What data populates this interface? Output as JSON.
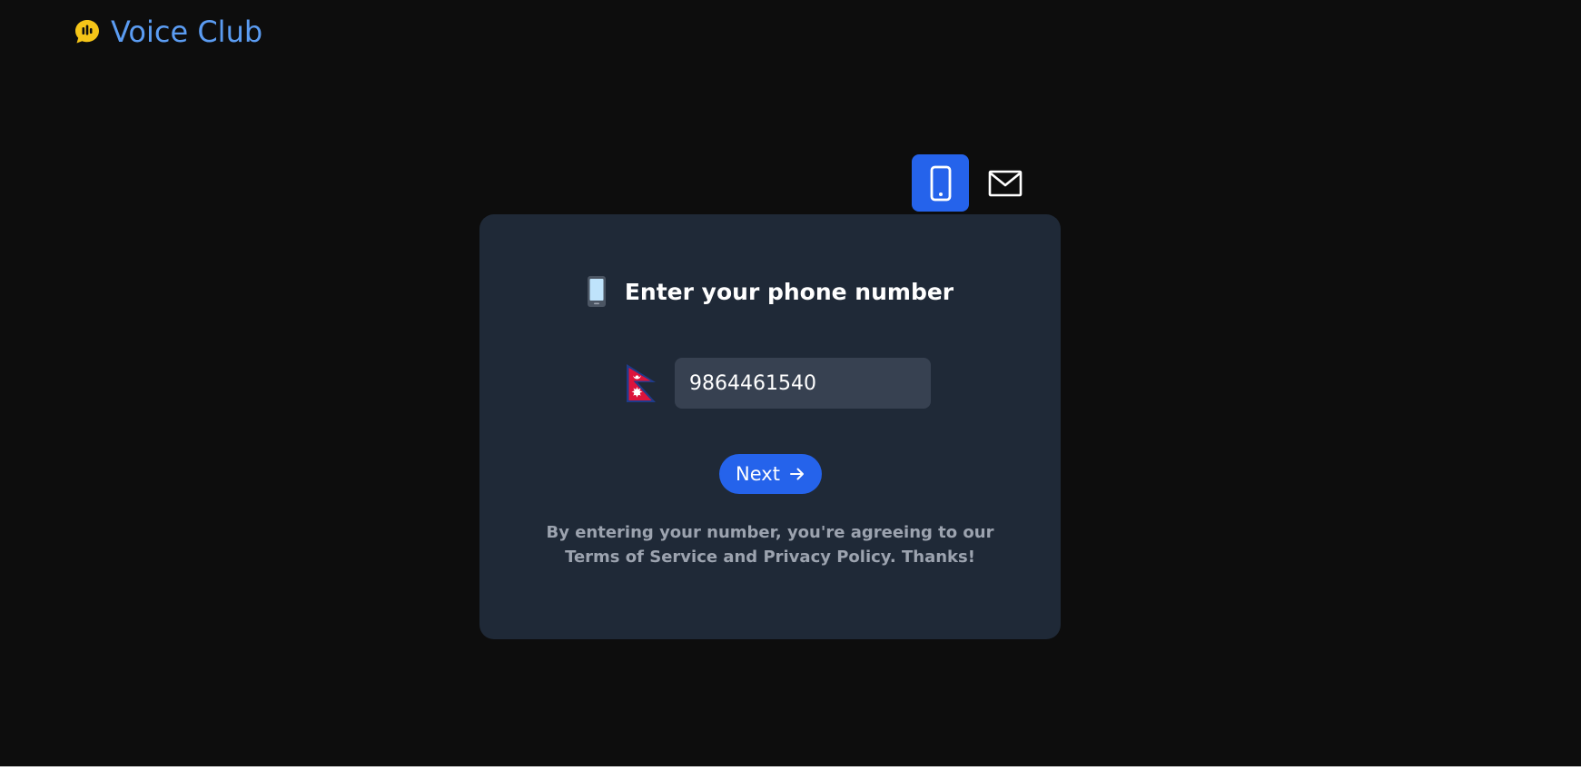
{
  "brand": {
    "name": "Voice Club",
    "logo_icon": "speech-bubble-audio-icon",
    "logo_color": "#f5c518",
    "text_color": "#5b9cf2"
  },
  "tabs": [
    {
      "icon": "phone-icon",
      "active": true
    },
    {
      "icon": "mail-icon",
      "active": false
    }
  ],
  "card": {
    "icon": "mobile-phone-icon",
    "heading": "Enter your phone number",
    "country_flag": "nepal-flag-icon",
    "phone_value": "9864461540",
    "next_label": "Next",
    "next_icon": "arrow-right-icon",
    "terms": "By entering your number, you're agreeing to our Terms of Service and Privacy Policy. Thanks!"
  },
  "colors": {
    "page_bg": "#0d0d0d",
    "card_bg": "#1f2937",
    "accent": "#2563eb",
    "input_bg": "#374151",
    "muted_text": "#9ca3af"
  }
}
